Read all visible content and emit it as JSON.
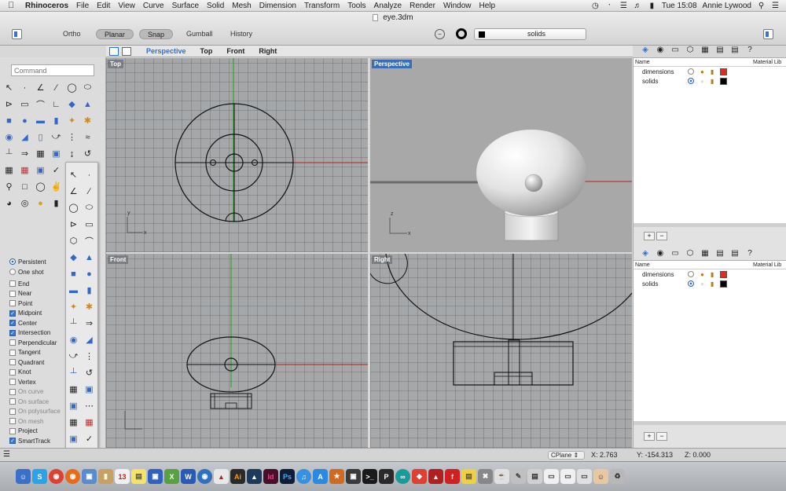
{
  "menubar": {
    "app": "Rhinoceros",
    "items": [
      "File",
      "Edit",
      "View",
      "Curve",
      "Surface",
      "Solid",
      "Mesh",
      "Dimension",
      "Transform",
      "Tools",
      "Analyze",
      "Render",
      "Window",
      "Help"
    ],
    "clock": "Tue 15:08",
    "user": "Annie Lywood"
  },
  "window": {
    "title": "eye.3dm",
    "modes": [
      "Ortho",
      "Planar",
      "Snap",
      "Gumball",
      "History"
    ],
    "current_layer": "solids"
  },
  "viewport_tabs": [
    "Perspective",
    "Top",
    "Front",
    "Right"
  ],
  "viewports": {
    "top": "Top",
    "perspective": "Perspective",
    "front": "Front",
    "right": "Right"
  },
  "command": {
    "placeholder": "Command"
  },
  "osnap": {
    "mode_persistent": "Persistent",
    "mode_oneshot": "One shot",
    "items": [
      {
        "label": "End",
        "checked": false,
        "dim": false
      },
      {
        "label": "Near",
        "checked": false,
        "dim": false
      },
      {
        "label": "Point",
        "checked": false,
        "dim": false
      },
      {
        "label": "Midpoint",
        "checked": true,
        "dim": false
      },
      {
        "label": "Center",
        "checked": true,
        "dim": false
      },
      {
        "label": "Intersection",
        "checked": true,
        "dim": false
      },
      {
        "label": "Perpendicular",
        "checked": false,
        "dim": false
      },
      {
        "label": "Tangent",
        "checked": false,
        "dim": false
      },
      {
        "label": "Quadrant",
        "checked": false,
        "dim": false
      },
      {
        "label": "Knot",
        "checked": false,
        "dim": false
      },
      {
        "label": "Vertex",
        "checked": false,
        "dim": false
      },
      {
        "label": "On curve",
        "checked": false,
        "dim": true
      },
      {
        "label": "On surface",
        "checked": false,
        "dim": true
      },
      {
        "label": "On polysurface",
        "checked": false,
        "dim": true
      },
      {
        "label": "On mesh",
        "checked": false,
        "dim": true
      },
      {
        "label": "Project",
        "checked": false,
        "dim": false
      },
      {
        "label": "SmartTrack",
        "checked": true,
        "dim": false
      }
    ]
  },
  "layers": {
    "col_name": "Name",
    "col_material": "Material Lib",
    "rows": [
      {
        "name": "dimensions",
        "color": "#e8281c"
      },
      {
        "name": "solids",
        "color": "#000000"
      }
    ]
  },
  "status": {
    "cplane": "CPlane",
    "x": "X: 2.763",
    "y": "Y: -154.313",
    "z": "Z: 0.000"
  },
  "axis": {
    "x": "x",
    "y": "y",
    "z": "z"
  },
  "colors": {
    "accent": "#2d6fd6",
    "viewport_bg": "#a6a8aa",
    "x_axis": "#b02020",
    "y_axis": "#1fa01f"
  }
}
